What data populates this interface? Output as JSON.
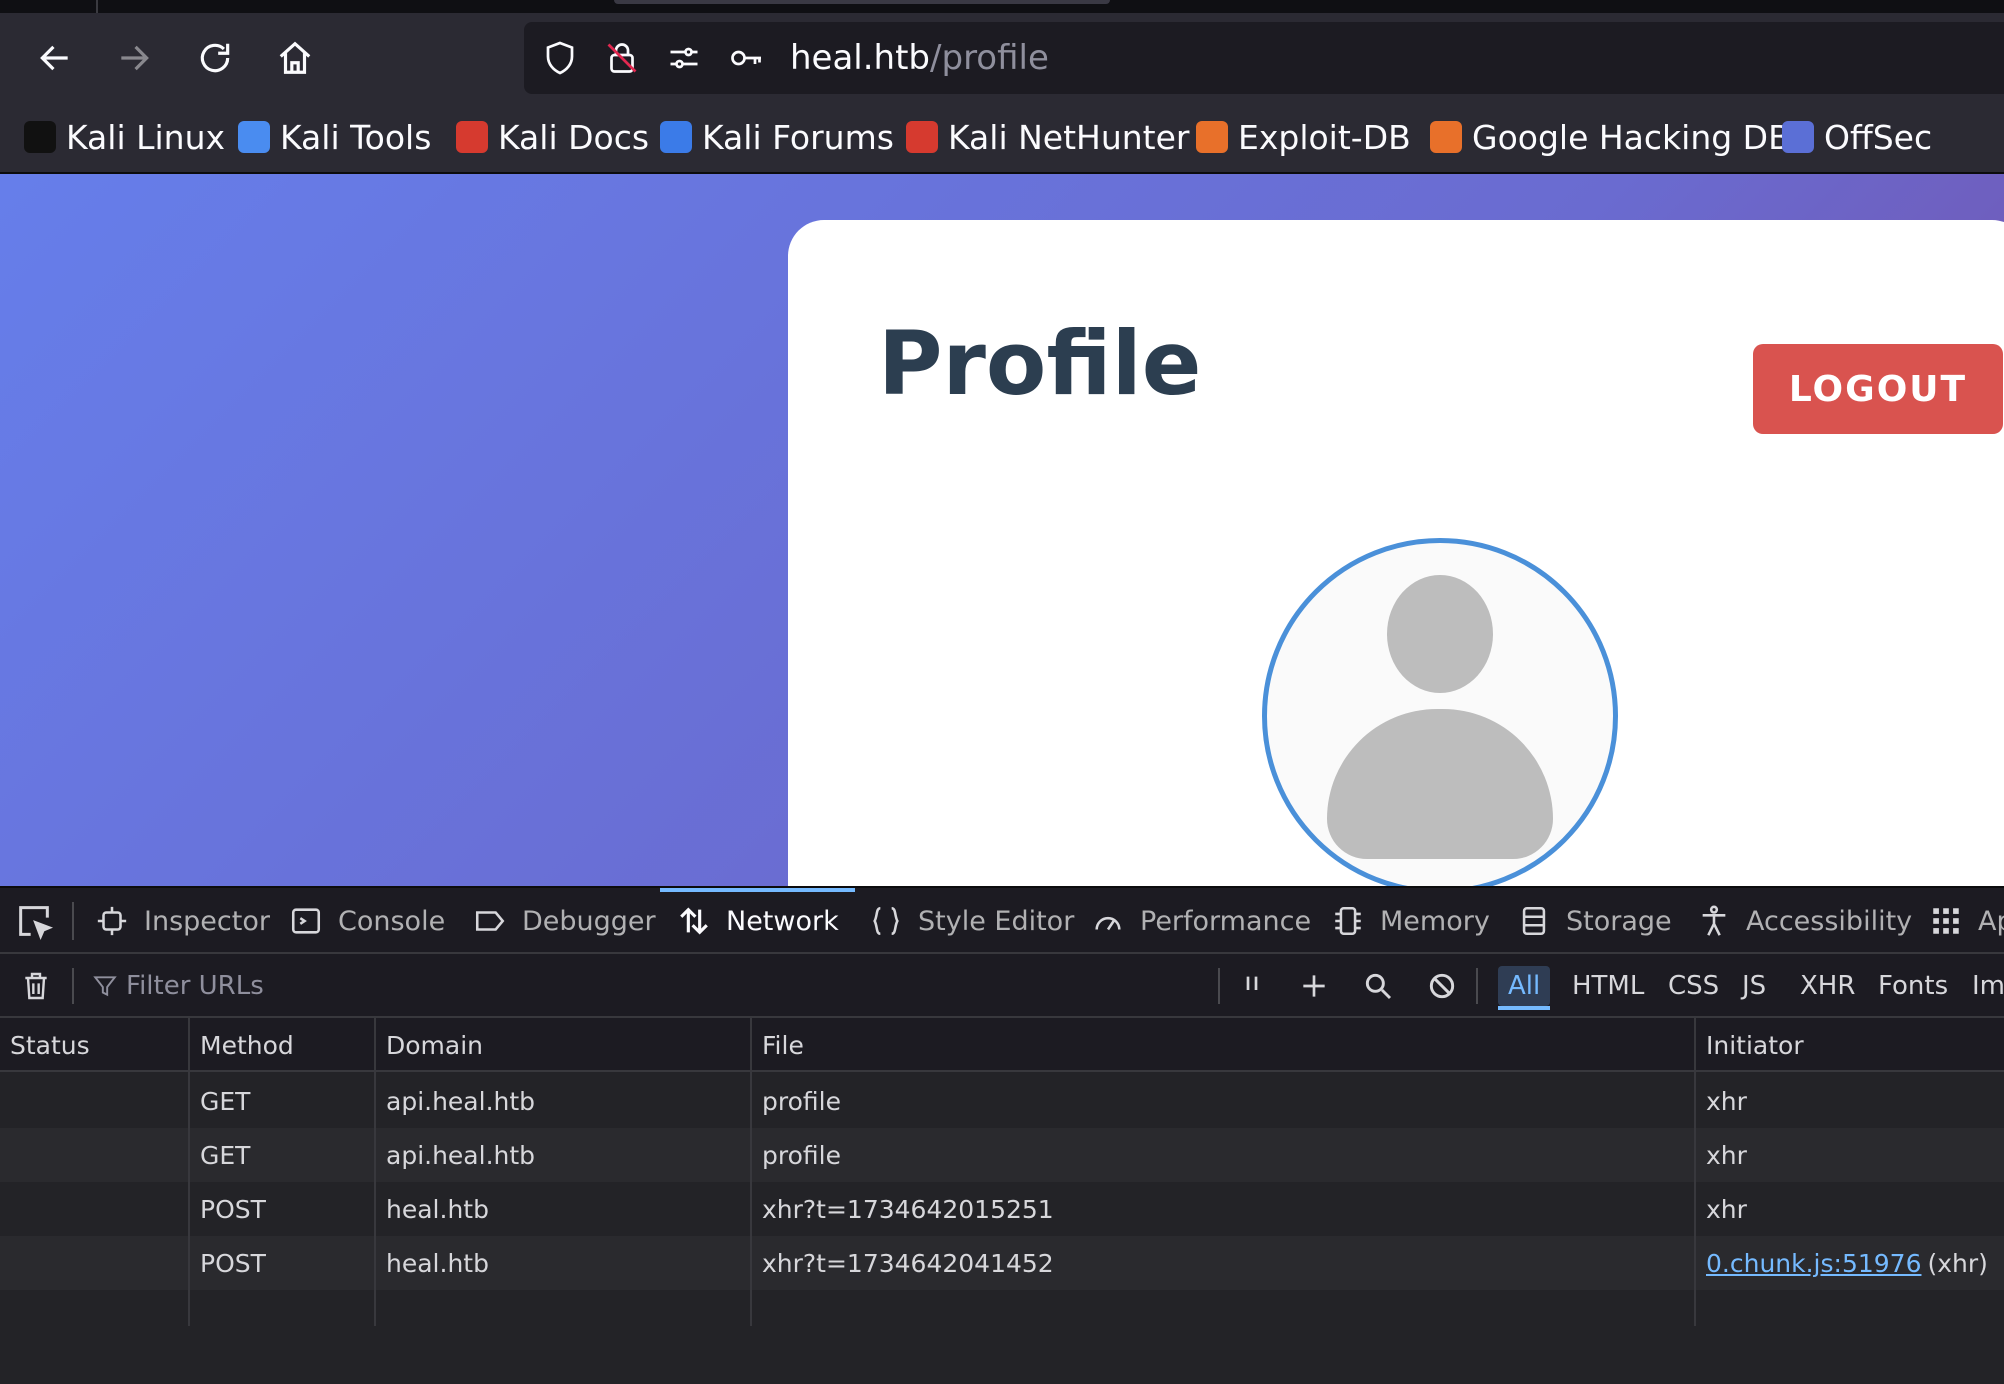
{
  "browser": {
    "url_host": "heal.htb",
    "url_path": "/profile",
    "nav_icons": [
      "back-arrow-icon",
      "forward-arrow-icon",
      "reload-icon",
      "home-icon"
    ],
    "url_icons": [
      "shield-icon",
      "blocked-lock-icon",
      "permissions-icon",
      "key-icon"
    ]
  },
  "bookmarks": [
    {
      "label": "Kali Linux",
      "color": "#1f1f1f"
    },
    {
      "label": "Kali Tools",
      "color": "#4a8cf0"
    },
    {
      "label": "Kali Docs",
      "color": "#d63a2f"
    },
    {
      "label": "Kali Forums",
      "color": "#3b7be8"
    },
    {
      "label": "Kali NetHunter",
      "color": "#d63a2f"
    },
    {
      "label": "Exploit-DB",
      "color": "#e8702a"
    },
    {
      "label": "Google Hacking DB",
      "color": "#e8702a"
    },
    {
      "label": "OffSec",
      "color": "#5b6fd6"
    }
  ],
  "page": {
    "title": "Profile",
    "logout_label": "LOGOUT",
    "accent": "#d9534f",
    "avatar_border": "#4a90d9"
  },
  "devtools": {
    "tabs": [
      {
        "label": "Inspector",
        "icon": "inspector-icon"
      },
      {
        "label": "Console",
        "icon": "console-icon"
      },
      {
        "label": "Debugger",
        "icon": "debugger-icon"
      },
      {
        "label": "Network",
        "icon": "network-icon"
      },
      {
        "label": "Style Editor",
        "icon": "style-editor-icon"
      },
      {
        "label": "Performance",
        "icon": "performance-icon"
      },
      {
        "label": "Memory",
        "icon": "memory-icon"
      },
      {
        "label": "Storage",
        "icon": "storage-icon"
      },
      {
        "label": "Accessibility",
        "icon": "accessibility-icon"
      },
      {
        "label": "Ap",
        "icon": "application-icon"
      }
    ],
    "active_tab": "Network",
    "filter_placeholder": "Filter URLs",
    "filter_types": [
      "All",
      "HTML",
      "CSS",
      "JS",
      "XHR",
      "Fonts",
      "Ima"
    ],
    "active_filter": "All",
    "columns": [
      "Status",
      "Method",
      "Domain",
      "File",
      "Initiator"
    ],
    "rows": [
      {
        "status": "",
        "method": "GET",
        "domain": "api.heal.htb",
        "file": "profile",
        "initiator": "xhr",
        "initiator_link": "",
        "initiator_suffix": ""
      },
      {
        "status": "",
        "method": "GET",
        "domain": "api.heal.htb",
        "file": "profile",
        "initiator": "xhr",
        "initiator_link": "",
        "initiator_suffix": ""
      },
      {
        "status": "",
        "method": "POST",
        "domain": "heal.htb",
        "file": "xhr?t=1734642015251",
        "initiator": "xhr",
        "initiator_link": "",
        "initiator_suffix": ""
      },
      {
        "status": "",
        "method": "POST",
        "domain": "heal.htb",
        "file": "xhr?t=1734642041452",
        "initiator": "",
        "initiator_link": "0.chunk.js:51976",
        "initiator_suffix": "(xhr)"
      }
    ]
  }
}
